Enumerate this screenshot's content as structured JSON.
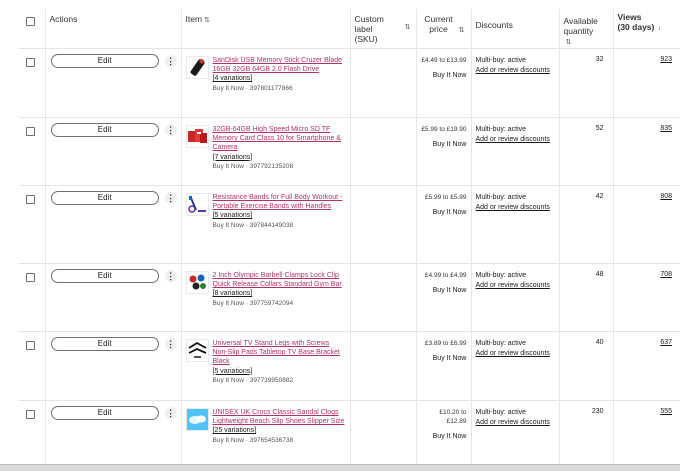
{
  "header": {
    "actions": "Actions",
    "item": "Item",
    "custom_label": "Custom label (SKU)",
    "current_price": "Current price",
    "discounts": "Discounts",
    "available_quantity": "Available quantity",
    "views": "Views (30 days)",
    "sort_icon": "sort-arrows-icon",
    "views_sort_icon": "sort-down-arrow-icon"
  },
  "edit_label": "Edit",
  "more_label": "⋮",
  "rows": [
    {
      "title": "SanDisk USB Memory Stick Cruzer Blade 16GB 32GB 64GB 2.0 Flash Drive",
      "variations": "[4 variations]",
      "meta": "Buy It Now · 397801177866",
      "price": "£4.49 to £13.99",
      "format": "Buy It Now",
      "discount_status": "Multi-buy: active",
      "discount_link": "Add or review discounts",
      "quantity": "32",
      "views": "923",
      "thumb_icon": "usb-stick-thumbnail"
    },
    {
      "title": "32GB-64GB High Speed Micro SD TF Memory Card Class 10 for Smartphone & Camera",
      "variations": "[7 variations]",
      "meta": "Buy It Now · 397792135208",
      "price": "£5.99 to £19.90",
      "format": "Buy It Now",
      "discount_status": "Multi-buy: active",
      "discount_link": "Add or review discounts",
      "quantity": "52",
      "views": "835",
      "thumb_icon": "memory-card-thumbnail"
    },
    {
      "title": "Resistance Bands for Full Body Workout - Portable Exercise Bands with Handles",
      "variations": "[5 variations]",
      "meta": "Buy It Now · 397844149038",
      "price": "£5.99 to £5.99",
      "format": "Buy It Now",
      "discount_status": "Multi-buy: active",
      "discount_link": "Add or review discounts",
      "quantity": "42",
      "views": "808",
      "thumb_icon": "resistance-bands-thumbnail"
    },
    {
      "title": "2 Inch Olympic Barbell Clamps Lock Clip Quick Release Collars Standard Gym Bar",
      "variations": "[8 variations]",
      "meta": "Buy It Now · 397759742094",
      "price": "£4.99 to £4.99",
      "format": "Buy It Now",
      "discount_status": "Multi-buy: active",
      "discount_link": "Add or review discounts",
      "quantity": "48",
      "views": "708",
      "thumb_icon": "barbell-clamps-thumbnail"
    },
    {
      "title": "Universal TV Stand Legs with Screws Non-Slip Pads Tabletop TV Base Bracket Black",
      "variations": "[5 variations]",
      "meta": "Buy It Now · 397739950882",
      "price": "£3.89 to £6.99",
      "format": "Buy It Now",
      "discount_status": "Multi-buy: active",
      "discount_link": "Add or review discounts",
      "quantity": "40",
      "views": "637",
      "thumb_icon": "tv-stand-legs-thumbnail"
    },
    {
      "title": "UNISEX UK Crocs Classic Sandal Clogs Lightweight Beach Slip Shoes Slipper Size",
      "variations": "[25 variations]",
      "meta": "Buy It Now · 397654536738",
      "price": "£10.20 to £12.89",
      "format": "Buy It Now",
      "discount_status": "Multi-buy: active",
      "discount_link": "Add or review discounts",
      "quantity": "230",
      "views": "555",
      "thumb_icon": "clogs-thumbnail"
    }
  ],
  "colors": {
    "title_link": "#b1316c",
    "border": "#e5e5e5"
  }
}
